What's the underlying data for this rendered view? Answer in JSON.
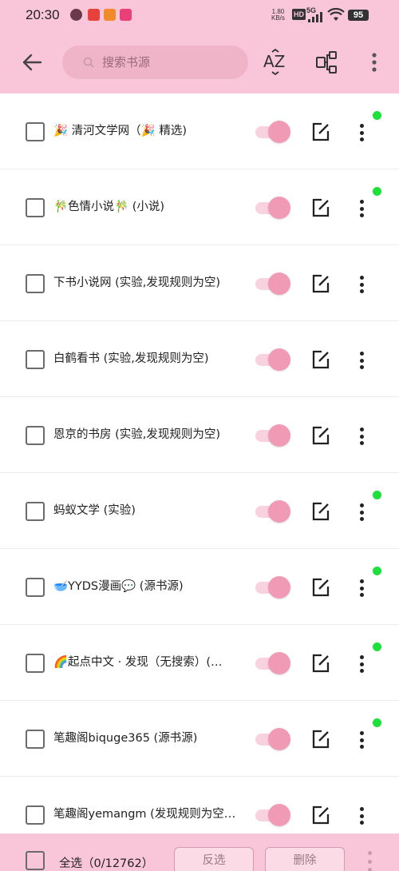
{
  "status_bar": {
    "time": "20:30",
    "net_speed_value": "1.80",
    "net_speed_unit": "KB/s",
    "hd_label": "HD",
    "network_label": "5G",
    "battery": "95"
  },
  "toolbar": {
    "search_placeholder": "搜索书源",
    "sort_icon_label": "AZ"
  },
  "sources": [
    {
      "name": "🎉 清河文学网（🎉 精选)",
      "enabled": true,
      "status_dot": true
    },
    {
      "name": "🎋色情小说🎋 (小说)",
      "enabled": true,
      "status_dot": true
    },
    {
      "name": "下书小说网 (实验,发现规则为空)",
      "enabled": true,
      "status_dot": false
    },
    {
      "name": "白鹤看书 (实验,发现规则为空)",
      "enabled": true,
      "status_dot": false
    },
    {
      "name": "恩京的书房 (实验,发现规则为空)",
      "enabled": true,
      "status_dot": false
    },
    {
      "name": "蚂蚁文学 (实验)",
      "enabled": true,
      "status_dot": true
    },
    {
      "name": "🥣YYDS漫画💬 (源书源)",
      "enabled": true,
      "status_dot": true
    },
    {
      "name": "🌈起点中文 · 发现（无搜索）(…",
      "enabled": true,
      "status_dot": true
    },
    {
      "name": "笔趣阁biquge365 (源书源)",
      "enabled": true,
      "status_dot": true
    },
    {
      "name": "笔趣阁yemangm (发现规则为空…",
      "enabled": true,
      "status_dot": false
    }
  ],
  "bottom_bar": {
    "select_all_label": "全选（0/12762）",
    "invert_label": "反选",
    "delete_label": "删除"
  },
  "colors": {
    "header_bg": "#f9c5d9",
    "toggle_on": "#f09ab6",
    "status_dot": "#1ee03b"
  }
}
